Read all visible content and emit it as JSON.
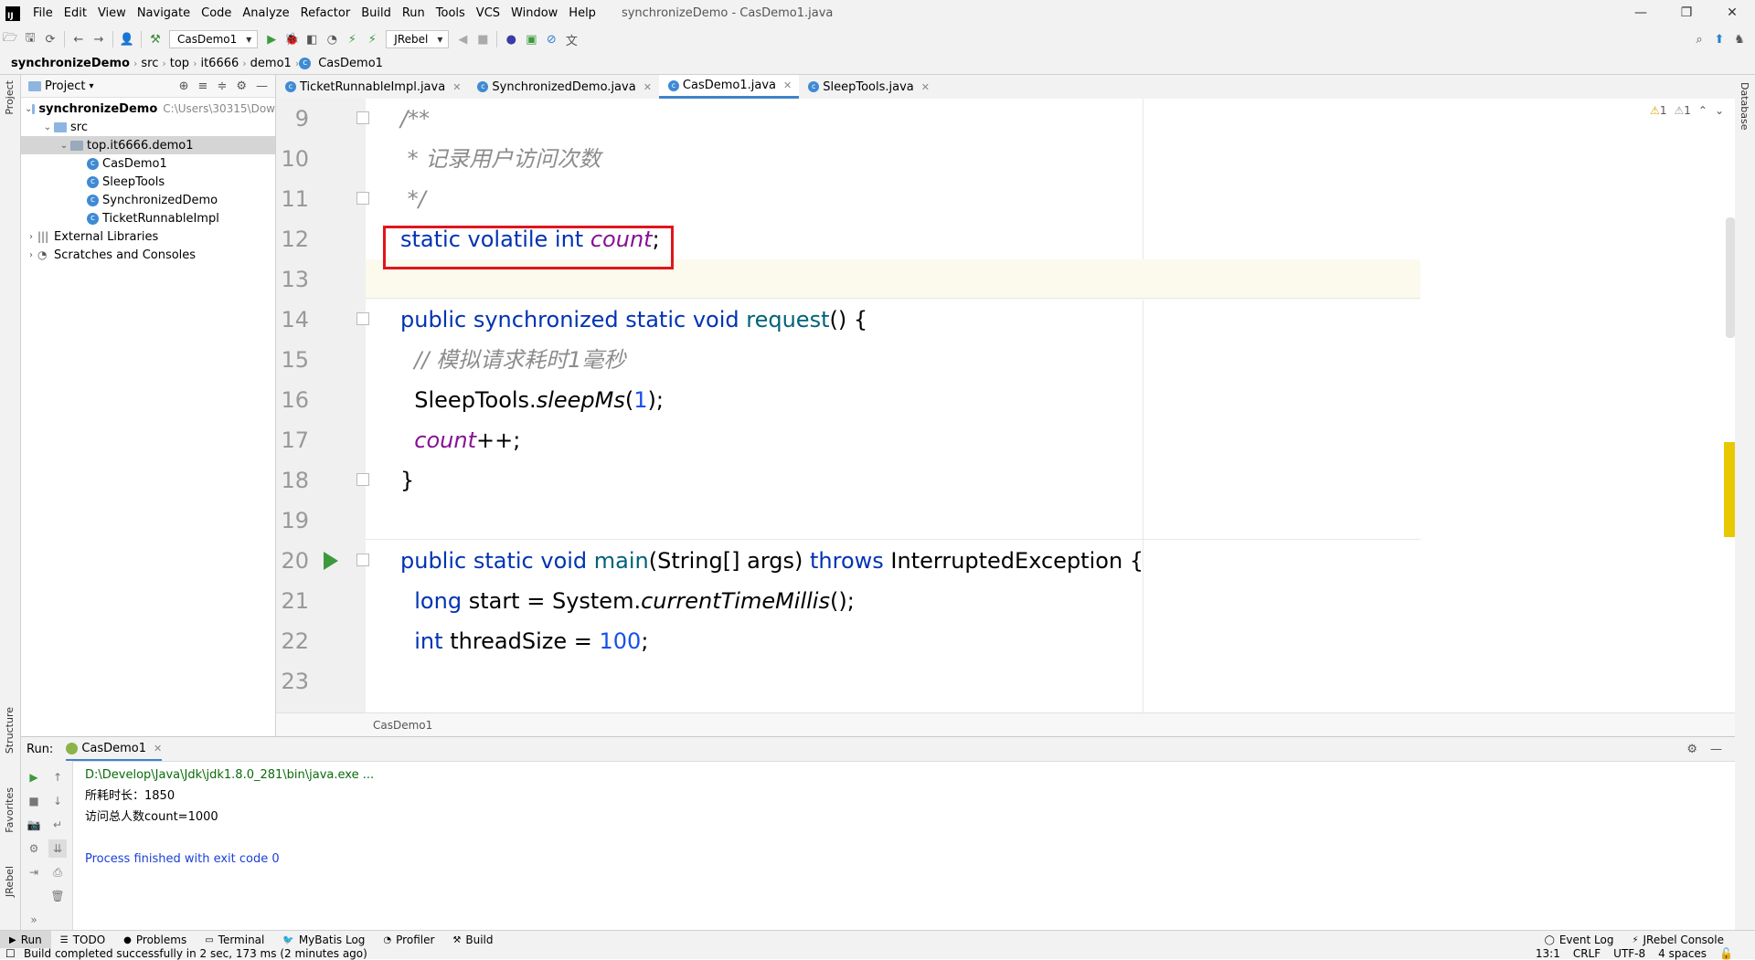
{
  "window": {
    "title": "synchronizeDemo - CasDemo1.java",
    "app_logo": "IJ",
    "controls": {
      "minimize": "—",
      "maximize": "❐",
      "close": "✕"
    }
  },
  "menu": [
    "File",
    "Edit",
    "View",
    "Navigate",
    "Code",
    "Analyze",
    "Refactor",
    "Build",
    "Run",
    "Tools",
    "VCS",
    "Window",
    "Help"
  ],
  "toolbar": {
    "run_config": "CasDemo1",
    "jrebel": "JRebel"
  },
  "breadcrumbs": [
    "synchronizeDemo",
    "src",
    "top",
    "it6666",
    "demo1",
    "CasDemo1"
  ],
  "left_strip": {
    "project": "Project",
    "structure": "Structure",
    "favorites": "Favorites",
    "jrebel": "JRebel"
  },
  "right_strip": {
    "database": "Database"
  },
  "project_panel": {
    "title": "Project",
    "tree": [
      {
        "label": "synchronizeDemo",
        "hint": "C:\\Users\\30315\\Dow",
        "level": 0,
        "type": "module",
        "open": true
      },
      {
        "label": "src",
        "level": 1,
        "type": "folder",
        "open": true
      },
      {
        "label": "top.it6666.demo1",
        "level": 2,
        "type": "package",
        "open": true,
        "selected": true
      },
      {
        "label": "CasDemo1",
        "level": 3,
        "type": "class"
      },
      {
        "label": "SleepTools",
        "level": 3,
        "type": "class"
      },
      {
        "label": "SynchronizedDemo",
        "level": 3,
        "type": "class"
      },
      {
        "label": "TicketRunnableImpl",
        "level": 3,
        "type": "class"
      },
      {
        "label": "External Libraries",
        "level": 0,
        "type": "lib",
        "open": false
      },
      {
        "label": "Scratches and Consoles",
        "level": 0,
        "type": "scratch",
        "open": false
      }
    ]
  },
  "editor_tabs": [
    {
      "label": "TicketRunnableImpl.java",
      "active": false
    },
    {
      "label": "SynchronizedDemo.java",
      "active": false
    },
    {
      "label": "CasDemo1.java",
      "active": true
    },
    {
      "label": "SleepTools.java",
      "active": false
    }
  ],
  "editor": {
    "inspection": {
      "warnings": "1",
      "weak_warnings": "1"
    },
    "lines": [
      {
        "n": "9",
        "html": "<span class='cmt'>/**</span>"
      },
      {
        "n": "10",
        "html": "<span class='cmt'> * 记录用户访问次数</span>"
      },
      {
        "n": "11",
        "html": "<span class='cmt'> */</span>"
      },
      {
        "n": "12",
        "html": "<span class='kw'>static volatile int</span> <span class='fld'>count</span>;"
      },
      {
        "n": "13",
        "html": ""
      },
      {
        "n": "14",
        "html": "<span class='kw'>public synchronized static void</span> <span class='fn'>request</span>() {"
      },
      {
        "n": "15",
        "html": "  <span class='cmt'>// 模拟请求耗时1毫秒</span>"
      },
      {
        "n": "16",
        "html": "  SleepTools.<span class='it'>sleepMs</span>(<span class='num'>1</span>);"
      },
      {
        "n": "17",
        "html": "  <span class='fld'>count</span>++;"
      },
      {
        "n": "18",
        "html": "}"
      },
      {
        "n": "19",
        "html": ""
      },
      {
        "n": "20",
        "html": "<span class='kw'>public static void</span> <span class='fn'>main</span>(String[] args) <span class='kw'>throws</span> InterruptedException {"
      },
      {
        "n": "21",
        "html": "  <span class='kw'>long</span> start = System.<span class='it'>currentTimeMillis</span>();"
      },
      {
        "n": "22",
        "html": "  <span class='kw'>int</span> threadSize = <span class='num'>100</span>;"
      },
      {
        "n": "23",
        "html": ""
      }
    ],
    "breadcrumb": "CasDemo1"
  },
  "run_panel": {
    "label": "Run:",
    "tab": "CasDemo1",
    "console": {
      "cmd": "D:\\Develop\\Java\\Jdk\\jdk1.8.0_281\\bin\\java.exe ...",
      "line1": "所耗时长：1850",
      "line2": "访问总人数count=1000",
      "finish": "Process finished with exit code 0"
    }
  },
  "bottom_tabs": [
    "Run",
    "TODO",
    "Problems",
    "Terminal",
    "MyBatis Log",
    "Profiler",
    "Build"
  ],
  "bottom_right_tabs": [
    "Event Log",
    "JRebel Console"
  ],
  "status": {
    "message": "Build completed successfully in 2 sec, 173 ms (2 minutes ago)",
    "position": "13:1",
    "line_sep": "CRLF",
    "encoding": "UTF-8",
    "indent": "4 spaces"
  },
  "colors": {
    "accent": "#4083c9",
    "highlight_box": "#e0151b",
    "keyword": "#0033b3",
    "field": "#871094",
    "comment": "#8c8c8c",
    "number": "#1750eb"
  }
}
